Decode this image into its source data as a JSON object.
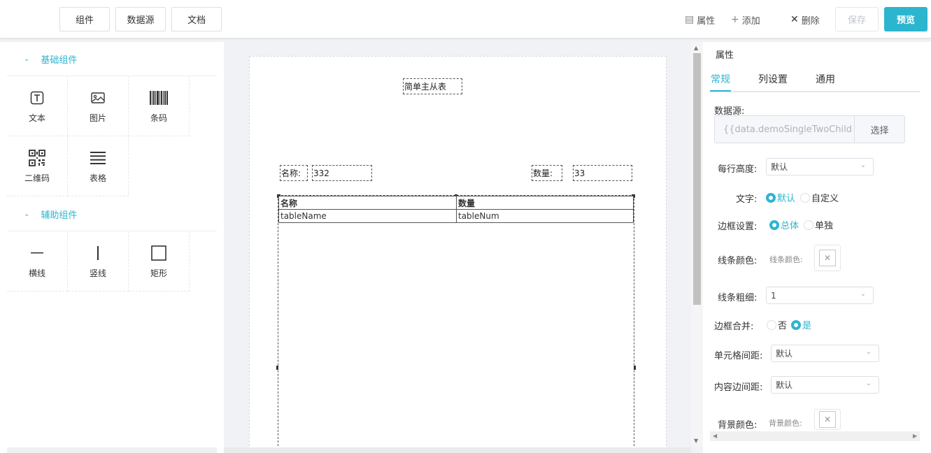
{
  "toolbar": {
    "tab_components": "组件",
    "tab_datasource": "数据源",
    "tab_docs": "文档",
    "properties_label": "属性",
    "add_label": "添加",
    "delete_label": "删除",
    "save_label": "保存",
    "preview_label": "预览",
    "accent_color": "#2cb5cf"
  },
  "left_panel": {
    "basic_group": {
      "title": "基础组件",
      "items": [
        {
          "label": "文本",
          "icon": "text-icon"
        },
        {
          "label": "图片",
          "icon": "image-icon"
        },
        {
          "label": "条码",
          "icon": "barcode-icon"
        },
        {
          "label": "二维码",
          "icon": "qrcode-icon"
        },
        {
          "label": "表格",
          "icon": "table-icon"
        }
      ]
    },
    "aux_group": {
      "title": "辅助组件",
      "items": [
        {
          "label": "横线",
          "icon": "horizontal-line-icon"
        },
        {
          "label": "竖线",
          "icon": "vertical-line-icon"
        },
        {
          "label": "矩形",
          "icon": "rectangle-icon"
        }
      ]
    }
  },
  "canvas": {
    "report_title": "简单主从表",
    "name_label": "名称:",
    "name_value": "332",
    "qty_label": "数量:",
    "qty_value": "33",
    "table": {
      "headers": [
        "名称",
        "数量"
      ],
      "row": [
        "tableName",
        "tableNum"
      ]
    }
  },
  "right_panel": {
    "title": "属性",
    "tabs": [
      "常规",
      "列设置",
      "通用"
    ],
    "datasource_label": "数据源:",
    "datasource_value": "{{data.demoSingleTwoChild",
    "datasource_button": "选择",
    "row_height_label": "每行高度:",
    "row_height_value": "默认",
    "text_label": "文字:",
    "text_option_default": "默认",
    "text_option_custom": "自定义",
    "border_setting_label": "边框设置:",
    "border_option_all": "总体",
    "border_option_single": "单独",
    "line_color_label": "线条颜色:",
    "line_color_hint": "线条颜色:",
    "line_width_label": "线条粗细:",
    "line_width_value": "1",
    "border_collapse_label": "边框合并:",
    "border_collapse_no": "否",
    "border_collapse_yes": "是",
    "cell_spacing_label": "单元格间距:",
    "cell_spacing_value": "默认",
    "padding_label": "内容边间距:",
    "padding_value": "默认",
    "bg_color_label": "背景颜色:",
    "bg_color_hint": "背景颜色:"
  }
}
